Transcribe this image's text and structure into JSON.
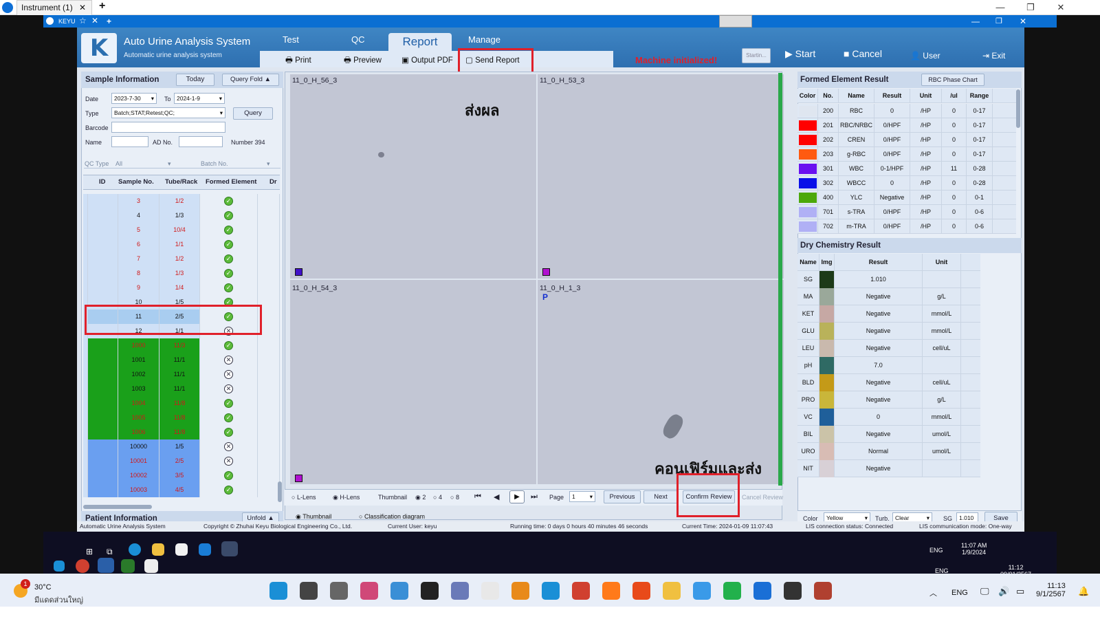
{
  "outer": {
    "tab_title": "Instrument (1)",
    "close": "✕",
    "new_tab": "+"
  },
  "remote": {
    "tab": "KEYU",
    "new": "+"
  },
  "app": {
    "title": "Auto Urine Analysis System",
    "subtitle": "Automatic urine analysis system",
    "logo": "K",
    "menu": [
      "Test",
      "QC",
      "Report",
      "Manage"
    ],
    "sub": {
      "print": "Print",
      "preview": "Preview",
      "output_pdf": "Output PDF",
      "send_report": "Send Report"
    },
    "status_msg": "Machine initialized!",
    "startin": "Startin...",
    "start": "Start",
    "cancel": "Cancel",
    "user": "User",
    "exit": "Exit"
  },
  "sample_info": {
    "title": "Sample Information",
    "today": "Today",
    "query_fold": "Query  Fold",
    "date_label": "Date",
    "date_from": "2023-7-30",
    "to_label": "To",
    "date_to": "2024-1-9",
    "type_label": "Type",
    "type_value": "Batch;STAT;Retest;QC;",
    "query": "Query",
    "barcode_label": "Barcode",
    "name_label": "Name",
    "ad_label": "AD No.",
    "number_label": "Number",
    "number_value": "394",
    "qc_type_label": "QC Type",
    "qc_type_value": "All",
    "batch_label": "Batch No.",
    "cols": [
      "ID",
      "Sample No.",
      "Tube/Rack",
      "Formed Element",
      "Dr"
    ]
  },
  "rows": [
    {
      "no": "3",
      "tube": "1/2",
      "fe": "ok",
      "bg": "#cfe0f6",
      "fg": "#d01818"
    },
    {
      "no": "4",
      "tube": "1/3",
      "fe": "ok",
      "bg": "#cfe0f6",
      "fg": "#111"
    },
    {
      "no": "5",
      "tube": "10/4",
      "fe": "ok",
      "bg": "#cfe0f6",
      "fg": "#d01818"
    },
    {
      "no": "6",
      "tube": "1/1",
      "fe": "ok",
      "bg": "#cfe0f6",
      "fg": "#d01818"
    },
    {
      "no": "7",
      "tube": "1/2",
      "fe": "ok",
      "bg": "#cfe0f6",
      "fg": "#d01818"
    },
    {
      "no": "8",
      "tube": "1/3",
      "fe": "ok",
      "bg": "#cfe0f6",
      "fg": "#d01818"
    },
    {
      "no": "9",
      "tube": "1/4",
      "fe": "ok",
      "bg": "#cfe0f6",
      "fg": "#d01818"
    },
    {
      "no": "10",
      "tube": "1/5",
      "fe": "ok",
      "bg": "#cfe0f6",
      "fg": "#111"
    },
    {
      "no": "11",
      "tube": "2/5",
      "fe": "ok",
      "bg": "#a9cdf0",
      "fg": "#111"
    },
    {
      "no": "12",
      "tube": "1/1",
      "fe": "x",
      "bg": "#cfe0f6",
      "fg": "#111"
    },
    {
      "no": "1000",
      "tube": "11/3",
      "fe": "ok",
      "bg": "#1aa01a",
      "fg": "#d01818"
    },
    {
      "no": "1001",
      "tube": "11/1",
      "fe": "x",
      "bg": "#1aa01a",
      "fg": "#111"
    },
    {
      "no": "1002",
      "tube": "11/1",
      "fe": "x",
      "bg": "#1aa01a",
      "fg": "#111"
    },
    {
      "no": "1003",
      "tube": "11/1",
      "fe": "x",
      "bg": "#1aa01a",
      "fg": "#111"
    },
    {
      "no": "1004",
      "tube": "11/8",
      "fe": "ok",
      "bg": "#1aa01a",
      "fg": "#d01818"
    },
    {
      "no": "1005",
      "tube": "11/8",
      "fe": "ok",
      "bg": "#1aa01a",
      "fg": "#d01818"
    },
    {
      "no": "1006",
      "tube": "11/8",
      "fe": "ok",
      "bg": "#1aa01a",
      "fg": "#d01818"
    },
    {
      "no": "10000",
      "tube": "1/5",
      "fe": "x",
      "bg": "#6a9ff0",
      "fg": "#111"
    },
    {
      "no": "10001",
      "tube": "2/5",
      "fe": "x",
      "bg": "#6a9ff0",
      "fg": "#d01818"
    },
    {
      "no": "10002",
      "tube": "3/5",
      "fe": "ok",
      "bg": "#6a9ff0",
      "fg": "#d01818"
    },
    {
      "no": "10003",
      "tube": "4/5",
      "fe": "ok",
      "bg": "#6a9ff0",
      "fg": "#d01818"
    }
  ],
  "patient": {
    "title": "Patient Information",
    "unfold": "Unfold"
  },
  "images": {
    "labels": [
      "11_0_H_56_3",
      "11_0_H_53_3",
      "11_0_H_54_3",
      "11_0_H_1_3"
    ],
    "p_mark": "P",
    "annot_top": "ส่งผล",
    "annot_bottom": "คอนเฟิร์มและส่ง",
    "l_lens": "L-Lens",
    "h_lens": "H-Lens",
    "thumbnail": "Thumbnail",
    "opts": [
      "2",
      "4",
      "8"
    ],
    "page": "Page",
    "page_value": "1",
    "previous": "Previous",
    "next": "Next",
    "confirm_review": "Confirm Review",
    "cancel_review": "Cancel Review",
    "thumb_tab": "Thumbnail",
    "class_tab": "Classification diagram"
  },
  "formed": {
    "title": "Formed Element Result",
    "rbc_chart": "RBC Phase Chart",
    "cols": [
      "Color",
      "No.",
      "Name",
      "Result",
      "Unit",
      "/ul",
      "Range"
    ],
    "rows": [
      {
        "color": "#dfe6f0",
        "no": "200",
        "name": "RBC",
        "result": "0",
        "unit": "/HP",
        "ul": "0",
        "range": "0-17"
      },
      {
        "color": "#ff0000",
        "no": "201",
        "name": "RBC/NRBC",
        "result": "0/HPF",
        "unit": "/HP",
        "ul": "0",
        "range": "0-17"
      },
      {
        "color": "#ff0000",
        "no": "202",
        "name": "CREN",
        "result": "0/HPF",
        "unit": "/HP",
        "ul": "0",
        "range": "0-17"
      },
      {
        "color": "#ff5a10",
        "no": "203",
        "name": "g-RBC",
        "result": "0/HPF",
        "unit": "/HP",
        "ul": "0",
        "range": "0-17"
      },
      {
        "color": "#6a10f0",
        "no": "301",
        "name": "WBC",
        "result": "0-1/HPF",
        "unit": "/HP",
        "ul": "11",
        "range": "0-28"
      },
      {
        "color": "#0a10e8",
        "no": "302",
        "name": "WBCC",
        "result": "0",
        "unit": "/HP",
        "ul": "0",
        "range": "0-28"
      },
      {
        "color": "#4ca80a",
        "no": "400",
        "name": "YLC",
        "result": "Negative",
        "unit": "/HP",
        "ul": "0",
        "range": "0-1"
      },
      {
        "color": "#b0b0f5",
        "no": "701",
        "name": "s-TRA",
        "result": "0/HPF",
        "unit": "/HP",
        "ul": "0",
        "range": "0-6"
      },
      {
        "color": "#b0b0f5",
        "no": "702",
        "name": "m-TRA",
        "result": "0/HPF",
        "unit": "/HP",
        "ul": "0",
        "range": "0-6"
      }
    ]
  },
  "dry": {
    "title": "Dry Chemistry Result",
    "cols": [
      "Name",
      "Img",
      "Result",
      "Unit"
    ],
    "rows": [
      {
        "name": "SG",
        "color": "#1d3a18",
        "result": "1.010",
        "unit": ""
      },
      {
        "name": "MA",
        "color": "#9aa89a",
        "result": "Negative",
        "unit": "g/L"
      },
      {
        "name": "KET",
        "color": "#c6a8a4",
        "result": "Negative",
        "unit": "mmol/L"
      },
      {
        "name": "GLU",
        "color": "#b9b25a",
        "result": "Negative",
        "unit": "mmol/L"
      },
      {
        "name": "LEU",
        "color": "#c9b9ad",
        "result": "Negative",
        "unit": "cell/uL"
      },
      {
        "name": "pH",
        "color": "#2f6a64",
        "result": "7.0",
        "unit": ""
      },
      {
        "name": "BLD",
        "color": "#c49a18",
        "result": "Negative",
        "unit": "cell/uL"
      },
      {
        "name": "PRO",
        "color": "#c9b63a",
        "result": "Negative",
        "unit": "g/L"
      },
      {
        "name": "VC",
        "color": "#1f5f9a",
        "result": "0",
        "unit": "mmol/L"
      },
      {
        "name": "BIL",
        "color": "#cbc3a8",
        "result": "Negative",
        "unit": "umol/L"
      },
      {
        "name": "URO",
        "color": "#d8bcb4",
        "result": "Normal",
        "unit": "umol/L"
      },
      {
        "name": "NIT",
        "color": "#d8d0d6",
        "result": "Negative",
        "unit": ""
      }
    ],
    "color_label": "Color",
    "color_value": "Yellow",
    "turb_label": "Turb.",
    "turb_value": "Clear",
    "sg_label": "SG",
    "sg_value": "1.010",
    "save": "Save"
  },
  "status": {
    "s1": "Automatic Urine Analysis System",
    "s2": "Copyright © Zhuhai Keyu Biological Engineering Co., Ltd.",
    "s3": "Current User: keyu",
    "s4": "Running time: 0 days 0 hours 40 minutes 46 seconds",
    "s5": "Current Time: 2024-01-09 11:07:43",
    "s6": "LIS connection status: Connected",
    "s7": "LIS communication mode: One-way"
  },
  "remote_task": {
    "lang": "ENG",
    "time": "11:07 AM",
    "date": "1/9/2024",
    "lang2": "ENG",
    "time2": "11:12",
    "date2": "09/01/2567"
  },
  "host_task": {
    "temp": "30°C",
    "weather": "มีแดดส่วนใหญ่",
    "badge": "1",
    "lang": "ENG",
    "time": "11:13",
    "date": "9/1/2567"
  }
}
